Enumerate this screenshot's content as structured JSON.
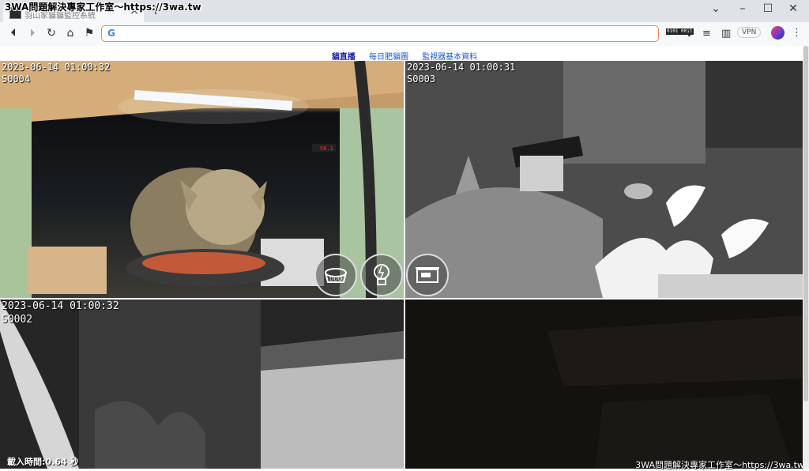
{
  "browser": {
    "tab_title": "羽山家貓貓監控系統",
    "overlay_title": "3WA問題解決專家工作室～https://3wa.tw",
    "address_value": "",
    "vpn_label": "VPN",
    "icons": {
      "favicon": "cat-camera-favicon",
      "back": "arrow-left-icon",
      "forward": "arrow-right-icon",
      "reload": "reload-icon",
      "home": "home-icon",
      "bookmark": "bookmark-icon",
      "google": "google-g-icon"
    },
    "extension_binary_text": "0101 0011"
  },
  "site_nav": {
    "items": [
      {
        "label": "貓直播",
        "active": true
      },
      {
        "label": "每日肥貓圖",
        "active": false
      },
      {
        "label": "監視器基本資料",
        "active": false
      }
    ]
  },
  "cameras": [
    {
      "timestamp": "2023-06-14 01:00:32",
      "id": "S0004"
    },
    {
      "timestamp": "2023-06-14 01:00:31",
      "id": "S0003"
    },
    {
      "timestamp": "2023-06-14 01:00:32",
      "id": "S0002"
    },
    {
      "timestamp": "",
      "id": ""
    }
  ],
  "controls": [
    {
      "name": "feeder-bowl",
      "label": "DDD"
    },
    {
      "name": "light-bulb",
      "label": ""
    },
    {
      "name": "weight-scale",
      "label": ""
    }
  ],
  "status": {
    "load_time": "載入時間:0.64 秒"
  },
  "footer": {
    "watermark": "3WA問題解決專家工作室～https://3wa.tw"
  },
  "colors": {
    "nav_link": "#1a56d6",
    "omnibox_border": "#f08a5d"
  }
}
